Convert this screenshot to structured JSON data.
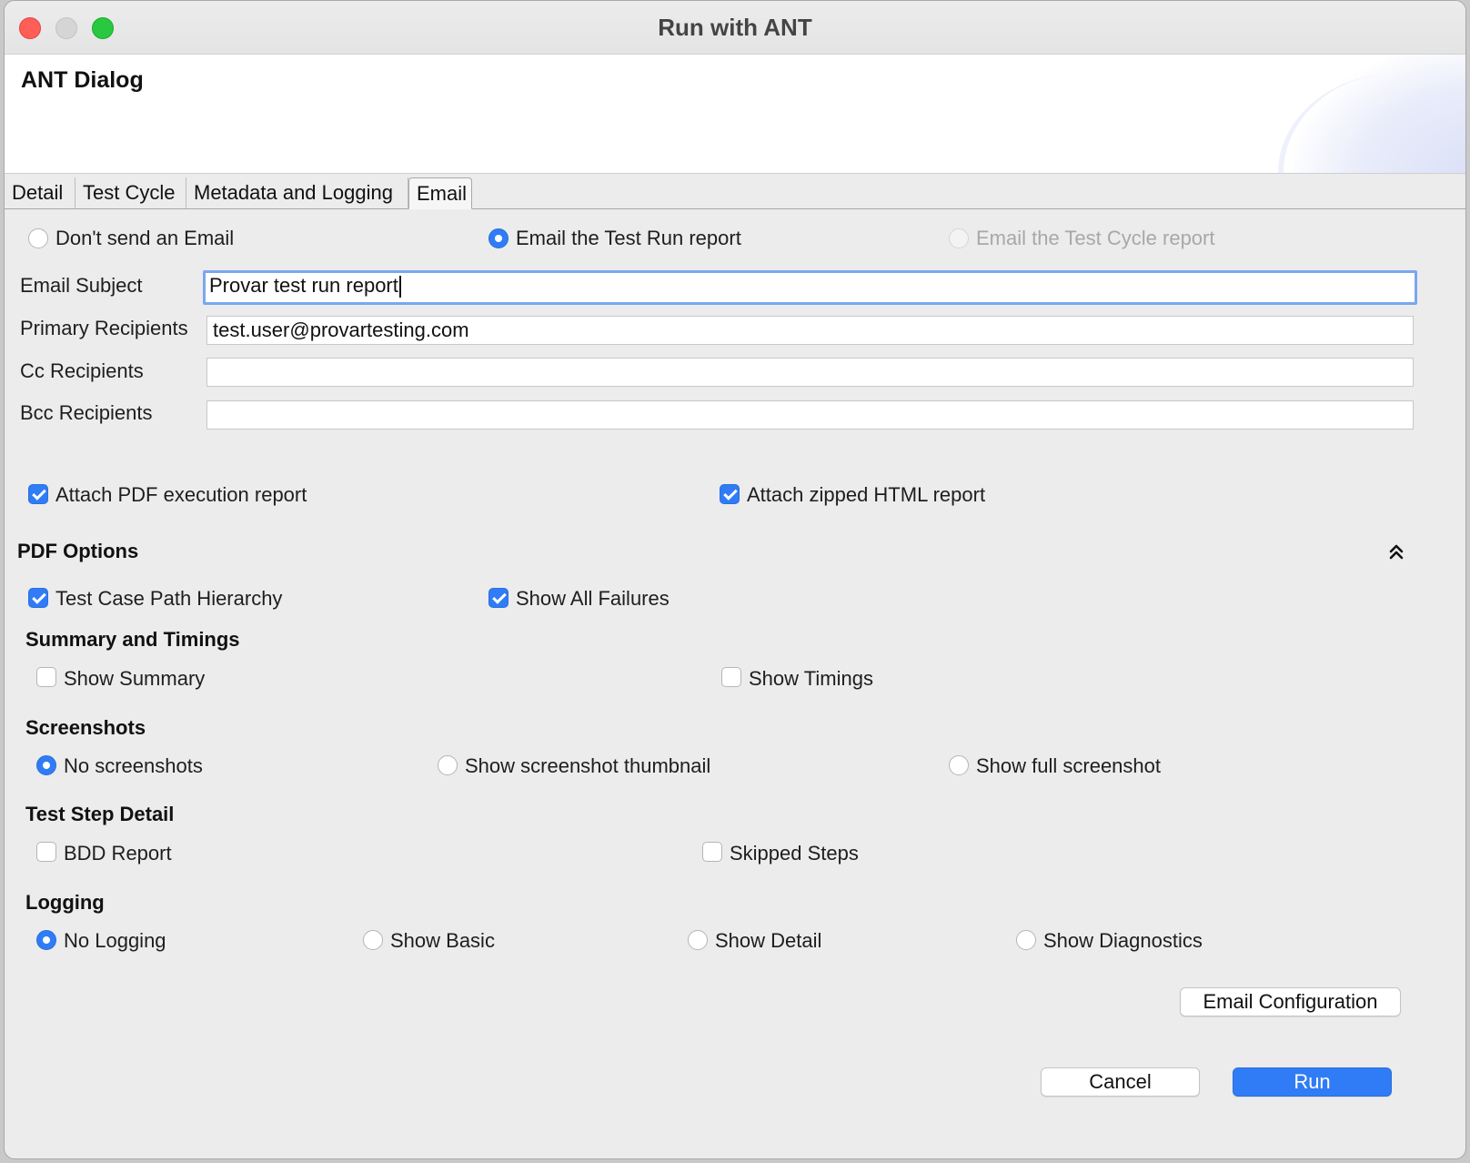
{
  "window": {
    "title": "Run with ANT"
  },
  "banner": {
    "title": "ANT Dialog"
  },
  "tabs": [
    {
      "label": "Detail"
    },
    {
      "label": "Test Cycle"
    },
    {
      "label": "Metadata and Logging"
    },
    {
      "label": "Email",
      "active": true
    }
  ],
  "email_mode": {
    "options": [
      {
        "label": "Don't send an Email",
        "selected": false
      },
      {
        "label": "Email the Test Run report",
        "selected": true
      },
      {
        "label": "Email the Test Cycle report",
        "selected": false,
        "disabled": true
      }
    ]
  },
  "fields": {
    "subject": {
      "label": "Email Subject",
      "value": "Provar test run report"
    },
    "primary": {
      "label": "Primary Recipients",
      "value": "test.user@provartesting.com"
    },
    "cc": {
      "label": "Cc Recipients",
      "value": ""
    },
    "bcc": {
      "label": "Bcc Recipients",
      "value": ""
    }
  },
  "attachments": {
    "pdf": {
      "label": "Attach PDF execution report",
      "checked": true
    },
    "html": {
      "label": "Attach zipped HTML report",
      "checked": true
    }
  },
  "pdf_options": {
    "title": "PDF Options",
    "path_hierarchy": {
      "label": "Test Case Path Hierarchy",
      "checked": true
    },
    "all_failures": {
      "label": "Show All Failures",
      "checked": true
    },
    "summary_title": "Summary and Timings",
    "show_summary": {
      "label": "Show Summary",
      "checked": false
    },
    "show_timings": {
      "label": "Show Timings",
      "checked": false
    },
    "screenshots_title": "Screenshots",
    "screenshots": [
      {
        "label": "No screenshots",
        "selected": true
      },
      {
        "label": "Show screenshot thumbnail",
        "selected": false
      },
      {
        "label": "Show full screenshot",
        "selected": false
      }
    ],
    "step_detail_title": "Test Step Detail",
    "bdd_report": {
      "label": "BDD Report",
      "checked": false
    },
    "skipped_steps": {
      "label": "Skipped Steps",
      "checked": false
    },
    "logging_title": "Logging",
    "logging": [
      {
        "label": "No Logging",
        "selected": true
      },
      {
        "label": "Show Basic",
        "selected": false
      },
      {
        "label": "Show Detail",
        "selected": false
      },
      {
        "label": "Show Diagnostics",
        "selected": false
      }
    ]
  },
  "buttons": {
    "email_config": "Email Configuration",
    "cancel": "Cancel",
    "run": "Run"
  },
  "colors": {
    "accent": "#2f7cf6",
    "focus_ring": "#7aa7f0"
  }
}
